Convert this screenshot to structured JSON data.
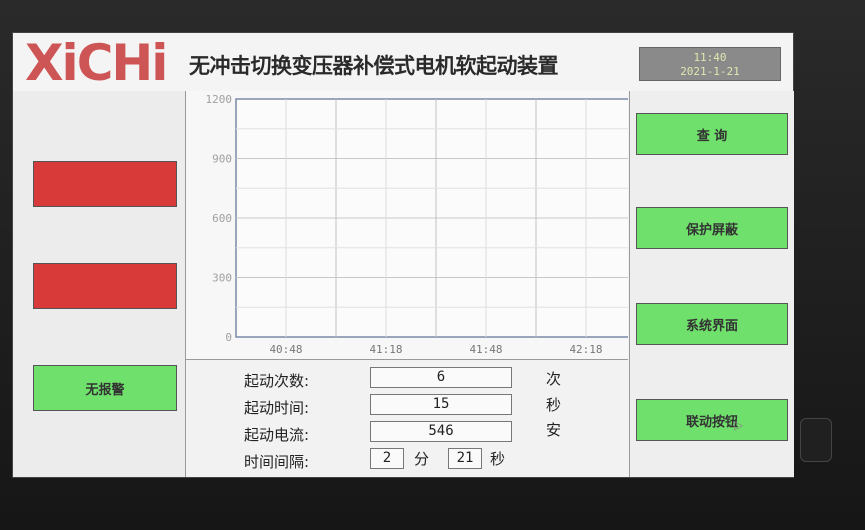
{
  "header": {
    "logo_text": "XiCHi",
    "title": "无冲击切换变压器补偿式电机软起动装置",
    "datetime_line1": "11:40",
    "datetime_line2": "2021-1-21"
  },
  "left_panel": {
    "status1_label": "",
    "status2_label": "",
    "alarm_label": "无报警"
  },
  "right_panel": {
    "buttons": [
      "查 询",
      "保护屏蔽",
      "系统界面",
      "联动按钮"
    ]
  },
  "info": {
    "rows": [
      {
        "label": "起动次数:",
        "value": "6",
        "unit": "次"
      },
      {
        "label": "起动时间:",
        "value": "15",
        "unit": "秒"
      },
      {
        "label": "起动电流:",
        "value": "546",
        "unit": "安"
      }
    ],
    "interval": {
      "label": "时间间隔:",
      "minutes": "2",
      "min_unit": "分",
      "seconds": "21",
      "sec_unit": "秒"
    }
  },
  "chart_data": {
    "type": "line",
    "title": "",
    "xlabel": "",
    "ylabel": "",
    "ylim": [
      0,
      1200
    ],
    "y_ticks": [
      "0",
      "300",
      "600",
      "900",
      "1200"
    ],
    "x_ticks": [
      "40:48",
      "41:18",
      "41:48",
      "42:18"
    ],
    "grid": true,
    "series": []
  },
  "colors": {
    "alarm_red": "#d83a3a",
    "ok_green": "#6fe06b",
    "logo_red": "#c73a3a"
  }
}
